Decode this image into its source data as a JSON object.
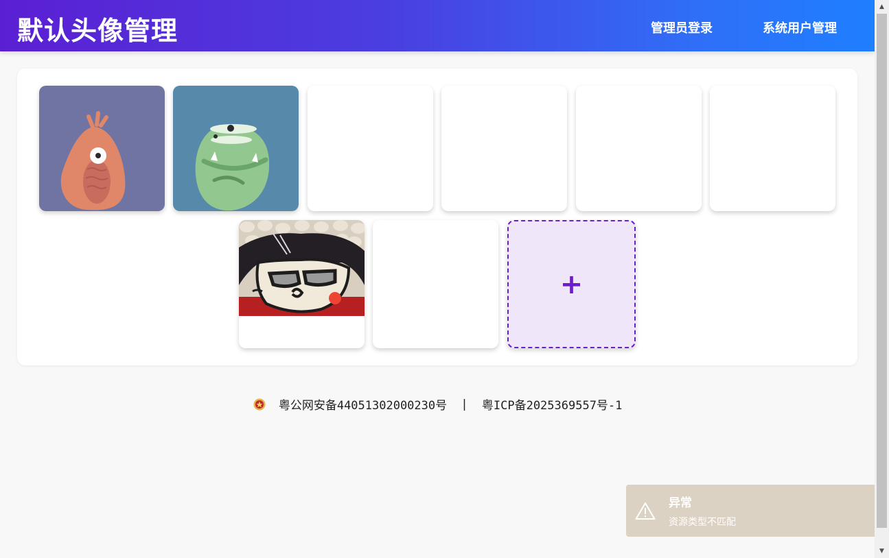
{
  "header": {
    "title": "默认头像管理",
    "nav": [
      {
        "label": "管理员登录"
      },
      {
        "label": "系统用户管理"
      }
    ]
  },
  "avatars": {
    "items": [
      {
        "type": "image",
        "subject": "orange one-eyed monster on purple background"
      },
      {
        "type": "image",
        "subject": "green monster on blue background"
      },
      {
        "type": "blank"
      },
      {
        "type": "blank"
      },
      {
        "type": "blank"
      },
      {
        "type": "blank"
      },
      {
        "type": "image",
        "subject": "cartoon face with glasses, partially loaded"
      },
      {
        "type": "blank"
      }
    ],
    "add_button": {
      "label": "+"
    }
  },
  "footer": {
    "police_icon": "police-badge-icon",
    "police_record": "粤公网安备44051302000230号",
    "separator": "|",
    "icp_record": "粤ICP备2025369557号-1"
  },
  "toast": {
    "icon": "warning-triangle-icon",
    "title": "异常",
    "message": "资源类型不匹配"
  },
  "colors": {
    "header_gradient_start": "#5b1fd3",
    "header_gradient_end": "#1e7fff",
    "accent": "#6a1ec8",
    "toast_bg": "#dbd2c4"
  }
}
